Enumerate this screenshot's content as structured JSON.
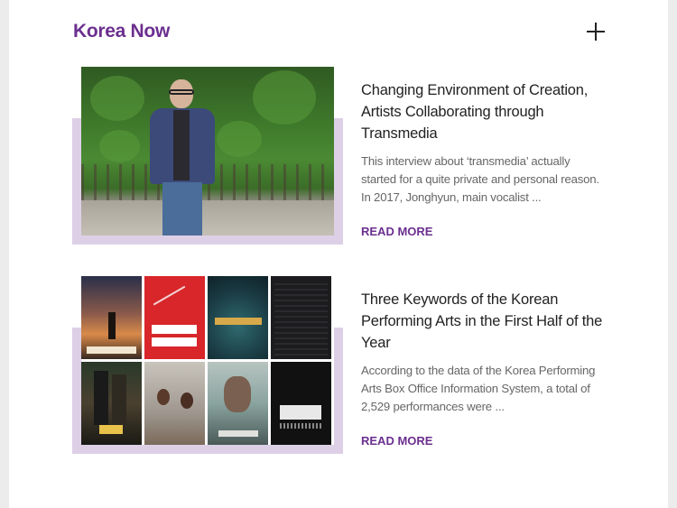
{
  "section": {
    "title": "Korea Now",
    "expand_icon": "plus-icon"
  },
  "articles": [
    {
      "title": "Changing Environment of Creation, Artists Collaborating through Transmedia",
      "excerpt": "This interview about ‘transmedia’ actually started for a quite private and personal reason. In 2017, Jonghyun, main vocalist ...",
      "read_more": "READ MORE"
    },
    {
      "title": "Three Keywords of the Korean Performing Arts in the First Half of the Year",
      "excerpt": "According to the data of the Korea Performing Arts Box Office Information System, a total of 2,529 performances were ...",
      "read_more": "READ MORE"
    }
  ],
  "colors": {
    "accent": "#6b2f8f",
    "thumb_backdrop": "#ddd0e6"
  }
}
